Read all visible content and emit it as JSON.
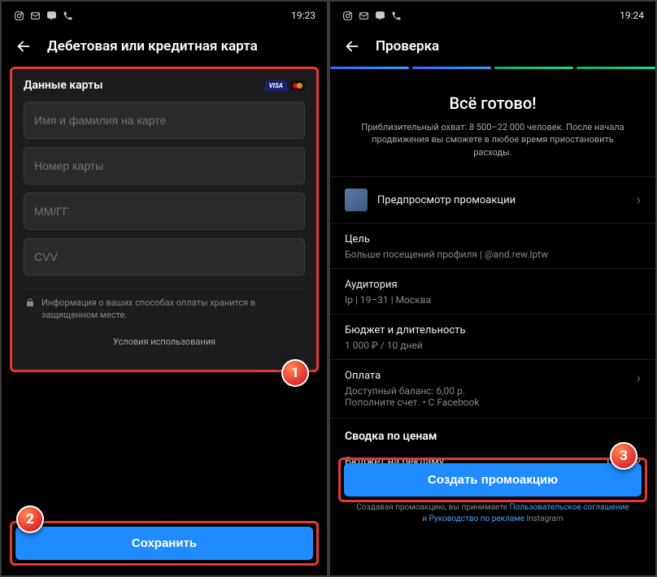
{
  "left": {
    "status": {
      "time": "19:23"
    },
    "header": {
      "title": "Дебетовая или кредитная карта"
    },
    "panel": {
      "title": "Данные карты",
      "name_placeholder": "Имя и фамилия на карте",
      "number_placeholder": "Номер карты",
      "exp_placeholder": "ММ/ГГ",
      "cvv_placeholder": "CVV",
      "lock_text": "Информация о ваших способах оплаты хранится в защищенном месте.",
      "terms": "Условия использования"
    },
    "save_button": "Сохранить",
    "markers": {
      "one": "1",
      "two": "2"
    }
  },
  "right": {
    "status": {
      "time": "19:24"
    },
    "header": {
      "title": "Проверка"
    },
    "ready": {
      "title": "Всё готово!",
      "subtitle": "Приблизительный охват: 8 500–22 000 человек. После начала продвижения вы сможете в любое время приостановить расходы."
    },
    "preview_row": "Предпросмотр промоакции",
    "goal": {
      "label": "Цель",
      "value": "Больше посещений профиля | @and.rew.lptw"
    },
    "audience": {
      "label": "Аудитория",
      "value": "Ір | 19–31 | Москва"
    },
    "budget": {
      "label": "Бюджет и длительность",
      "value": "1 000 ₽ / 10 дней"
    },
    "payment": {
      "label": "Оплата",
      "value1": "Доступный баланс: 6,00 р.",
      "value2": "Пополните счет. • С Facebook"
    },
    "summary": {
      "header": "Сводка по ценам",
      "row_label": "Бюджет на рекламу",
      "row_value": "1 000 ₽"
    },
    "create_button": "Создать промоакцию",
    "disclaimer": {
      "prefix": "Создавая промоакцию, вы принимаете ",
      "link1": "Пользовательское соглашение",
      "mid": " и ",
      "link2": "Руководство по рекламе",
      "suffix": " Instagram"
    },
    "markers": {
      "three": "3"
    }
  }
}
